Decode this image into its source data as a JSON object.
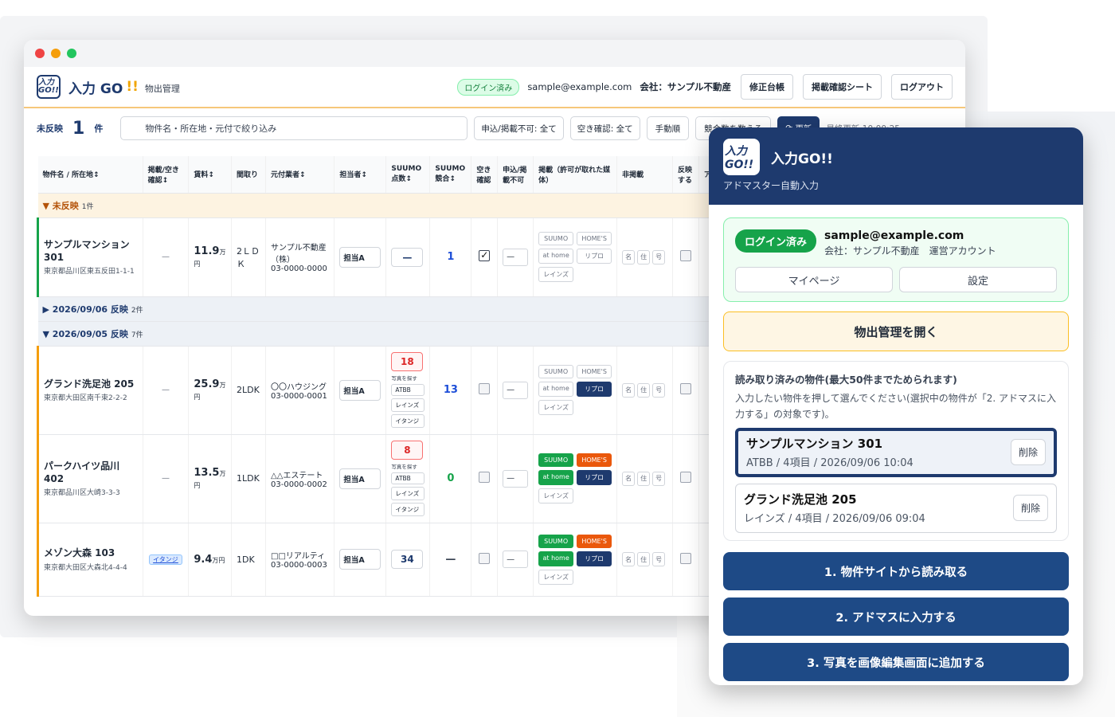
{
  "app": {
    "logo_text": "入力GO!!",
    "brand": "入力 GO",
    "brand_ex": "!!",
    "subtitle": "物出管理",
    "login_badge": "ログイン済み",
    "email": "sample@example.com",
    "company": "会社：サンプル不動産",
    "buttons": [
      "修正台帳",
      "掲載確認シート",
      "ログアウト"
    ]
  },
  "filter": {
    "count_label": "未反映",
    "count_value": "1",
    "count_unit": "件",
    "search_placeholder": "物件名・所在地・元付で絞り込み",
    "select_apply": "申込/掲載不可: 全て",
    "select_vacancy": "空き確認: 全て",
    "btn_manual": "手動順",
    "btn_count": "競合数を数える",
    "btn_update": "更新",
    "last_update": "最終更新 10:00:25"
  },
  "table": {
    "headers": [
      "物件名 / 所在地↕",
      "掲載/空き確認↕",
      "賃料↕",
      "間取り",
      "元付業者↕",
      "担当者↕",
      "SUUMO点数↕",
      "SUUMO競合↕",
      "空き確認",
      "申込/掲載不可",
      "掲載（許可が取れた媒体）",
      "非掲載",
      "反映する",
      "ア"
    ],
    "groups": {
      "unreflected": {
        "label": "▼ 未反映",
        "count": "1件"
      },
      "g0906": {
        "label": "▶ 2026/09/06 反映",
        "count": "2件"
      },
      "g0905": {
        "label": "▼ 2026/09/05 反映",
        "count": "7件"
      }
    },
    "rows": [
      {
        "name": "サンプルマンション 301",
        "addr": "東京都品川区東五反田1-1-1",
        "listing": "—",
        "rent": "11.9",
        "unit": "万円",
        "layout": "2ＬＤＫ",
        "agent": "サンプル不動産（株）",
        "tel": "03-0000-0000",
        "staff": "担当A",
        "score": "—",
        "comp": "1",
        "apply": "—"
      },
      {
        "name": "グランド洗足池 205",
        "addr": "東京都大田区南千束2-2-2",
        "listing": "—",
        "rent": "25.9",
        "unit": "万円",
        "layout": "2LDK",
        "agent": "〇〇ハウジング",
        "tel": "03-0000-0001",
        "staff": "担当A",
        "score": "18",
        "comp": "13",
        "apply": "—"
      },
      {
        "name": "パークハイツ品川 402",
        "addr": "東京都品川区大崎3-3-3",
        "listing": "—",
        "rent": "13.5",
        "unit": "万円",
        "layout": "1LDK",
        "agent": "△△エステート",
        "tel": "03-0000-0002",
        "staff": "担当A",
        "score": "8",
        "comp": "0",
        "apply": "—"
      },
      {
        "name": "メゾン大森 103",
        "addr": "東京都大田区大森北4-4-4",
        "listing": "イタンジ",
        "rent": "9.4",
        "unit": "万円",
        "layout": "1DK",
        "agent": "□□リアルティ",
        "tel": "03-0000-0003",
        "staff": "担当A",
        "score": "34",
        "comp": "—",
        "apply": "—"
      }
    ],
    "mini_labels": {
      "search": "写真を探す",
      "atbb": "ATBB",
      "reins": "レインズ",
      "itandi": "イタンジ"
    },
    "media": {
      "suumo": "SUUMO",
      "homes": "HOME'S",
      "athome": "at home",
      "ripuro": "リプロ",
      "reins": "レインズ"
    },
    "hide": [
      "名",
      "住",
      "号"
    ]
  },
  "ext": {
    "title": "入力GO!!",
    "subtitle": "アドマスター自動入力",
    "login_badge": "ログイン済み",
    "email": "sample@example.com",
    "company": "会社：サンプル不動産　運営アカウント",
    "btn_mypage": "マイページ",
    "btn_settings": "設定",
    "btn_open": "物出管理を開く",
    "list_title": "読み取り済みの物件(最大50件までためられます)",
    "list_desc": "入力したい物件を押して選んでください(選択中の物件が「2. アドマスに入力する」の対象です)。",
    "items": [
      {
        "name": "サンプルマンション 301",
        "meta": "ATBB / 4項目 / 2026/09/06 10:04"
      },
      {
        "name": "グランド洗足池 205",
        "meta": "レインズ / 4項目 / 2026/09/06 09:04"
      }
    ],
    "delete_label": "削除",
    "actions": [
      "1. 物件サイトから読み取る",
      "2. アドマスに入力する",
      "3. 写真を画像編集画面に追加する"
    ]
  }
}
